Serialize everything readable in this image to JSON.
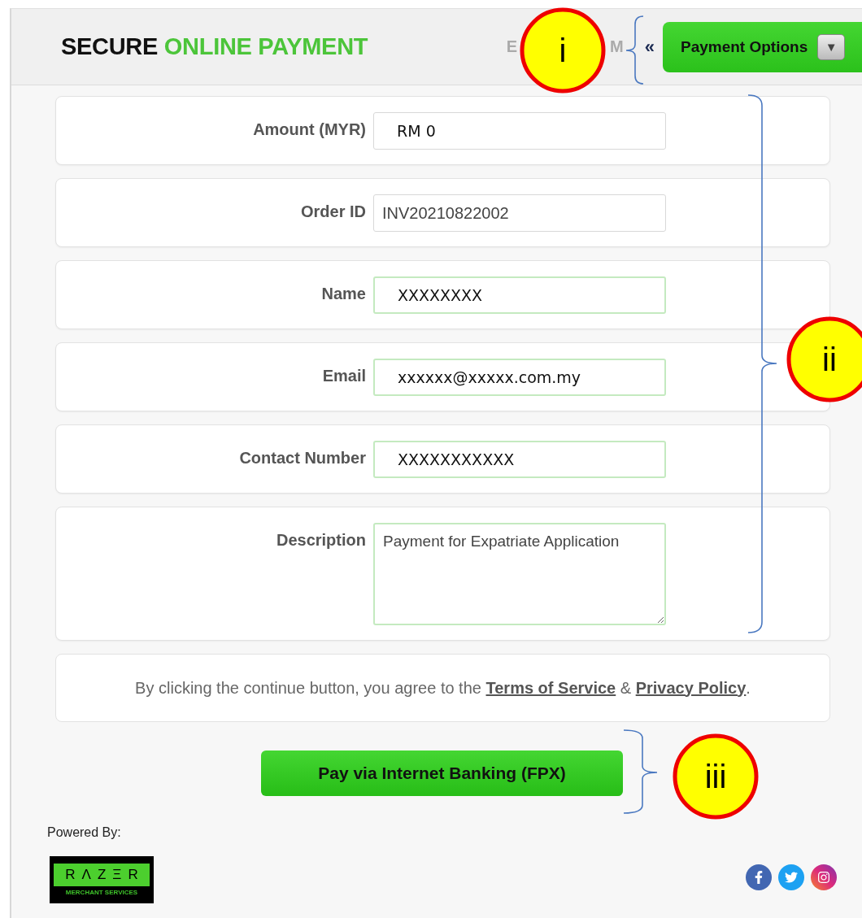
{
  "header": {
    "title_main": "SECURE",
    "title_accent": "ONLINE PAYMENT",
    "partial_left": "E",
    "partial_right": "M",
    "back_glyph": "«",
    "menu_button": {
      "label": "Payment Options",
      "glyph": "▼"
    }
  },
  "fields": [
    {
      "label": "Amount (MYR)",
      "value": "RM 0",
      "kind": "large-input",
      "readonly": true
    },
    {
      "label": "Order ID",
      "value": "INV20210822002",
      "kind": "input",
      "readonly": true
    },
    {
      "label": "Name",
      "value": "XXXXXXXX",
      "kind": "large-input",
      "readonly": false
    },
    {
      "label": "Email",
      "value": "xxxxxx@xxxxx.com.my",
      "kind": "large-input",
      "readonly": false
    },
    {
      "label": "Contact Number",
      "value": "XXXXXXXXXXX",
      "kind": "large-input",
      "readonly": false
    },
    {
      "label": "Description",
      "value": "Payment for Expatriate Application",
      "kind": "textarea",
      "readonly": false
    }
  ],
  "terms": {
    "text_before": "By clicking the continue button, you agree to the",
    "link_1": "Terms of Service",
    "joiner": "&",
    "link_2": "Privacy Policy",
    "text_after": "."
  },
  "pay_button": "Pay via Internet Banking (FPX)",
  "footer": {
    "powered_by": "Powered By:",
    "logo_wordmark": "RΛZΞR",
    "logo_tagline": "MERCHANT SERVICES"
  },
  "annotations": [
    {
      "label": "i"
    },
    {
      "label": "ii"
    },
    {
      "label": "iii"
    }
  ]
}
